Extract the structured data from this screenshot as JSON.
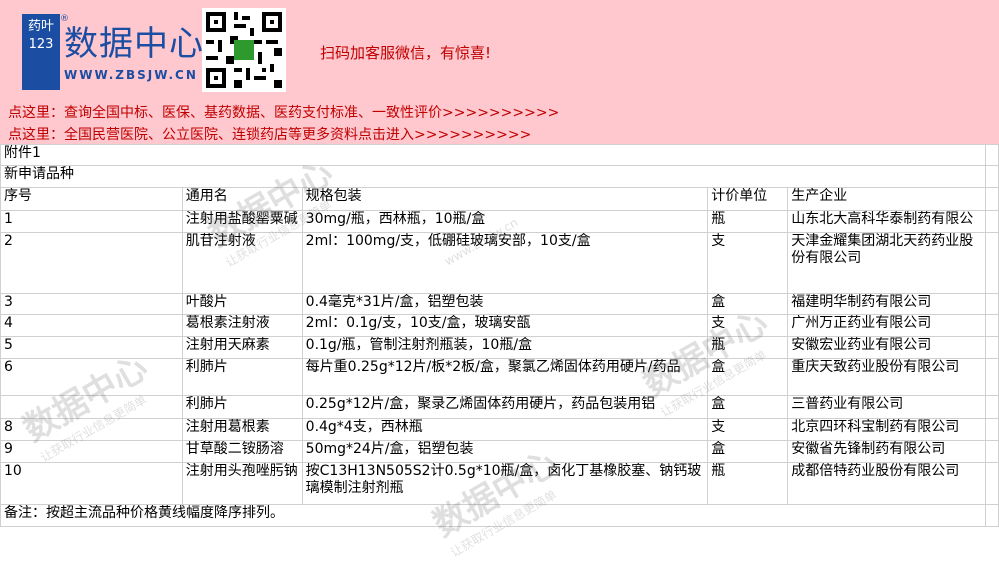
{
  "banner": {
    "logo_box_text": "药叶123",
    "logo_title": "数据中心",
    "logo_url": "WWW.ZBSJW.CN",
    "scan_text": "扫码加客服微信，有惊喜!",
    "link1": "点这里：查询全国中标、医保、基药数据、医药支付标准、一致性评价>>>>>>>>>>",
    "link2": "点这里：全国民营医院、公立医院、连锁药店等更多资料点击进入>>>>>>>>>>"
  },
  "watermark": {
    "title": "数据中心",
    "subtitle": "让获取行业信息更简单",
    "url": "www.zbsjw.cn"
  },
  "sheet": {
    "attachment": "附件1",
    "section_title": "新申请品种",
    "headers": [
      "序号",
      "通用名",
      "规格包装",
      "计价单位",
      "生产企业"
    ],
    "rows": [
      [
        "1",
        "注射用盐酸罂粟碱",
        "30mg/瓶，西林瓶，10瓶/盒",
        "瓶",
        "山东北大高科华泰制药有限公"
      ],
      [
        "2",
        "肌苷注射液",
        "2ml：100mg/支，低硼硅玻璃安部，10支/盒",
        "支",
        "天津金耀集团湖北天药药业股份有限公司"
      ],
      [
        "3",
        "叶酸片",
        "0.4毫克*31片/盒，铝塑包装",
        "盒",
        "福建明华制药有限公司"
      ],
      [
        "4",
        "葛根素注射液",
        "2ml：0.1g/支，10支/盒，玻璃安瓿",
        "支",
        "广州万正药业有限公司"
      ],
      [
        "5",
        "注射用天麻素",
        "0.1g/瓶，管制注射剂瓶装，10瓶/盒",
        "瓶",
        "安徽宏业药业有限公司"
      ],
      [
        "6",
        "利肺片",
        "每片重0.25g*12片/板*2板/盒，聚氯乙烯固体药用硬片/药品",
        "盒",
        "重庆天致药业股份有限公司"
      ],
      [
        "",
        "利肺片",
        "0.25g*12片/盒，聚录乙烯固体药用硬片，药品包装用铝",
        "盒",
        "三普药业有限公司"
      ],
      [
        "8",
        "注射用葛根素",
        "0.4g*4支，西林瓶",
        "支",
        "北京四环科宝制药有限公司"
      ],
      [
        "9",
        "甘草酸二铵肠溶",
        "50mg*24片/盒，铝塑包装",
        "盒",
        "安徽省先锋制药有限公司"
      ],
      [
        "10",
        "注射用头孢唑肟钠",
        "按C13H13N505S2计0.5g*10瓶/盒，卤化丁基橡胶塞、钠钙玻璃模制注射剂瓶",
        "瓶",
        "成都倍特药业股份有限公司"
      ]
    ],
    "note": "备注：按超主流品种价格黄线幅度降序排列。"
  }
}
